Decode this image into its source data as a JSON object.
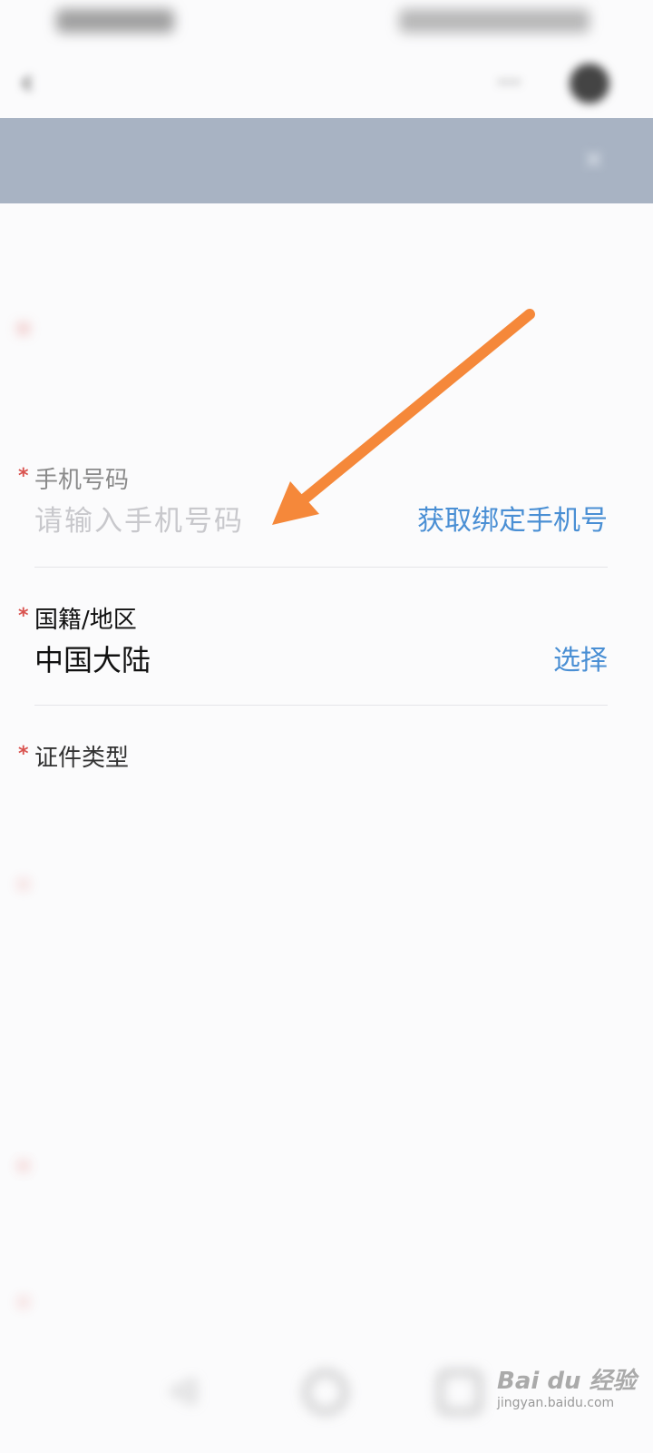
{
  "status_bar": {
    "left_text": "",
    "right_text": ""
  },
  "header": {
    "title": "",
    "back_icon": "chevron-left-icon",
    "more_icon": "more-dots-icon",
    "menu_icon": "target-circle-icon"
  },
  "notice": {
    "text": "",
    "close_icon": "close-icon"
  },
  "section": {
    "title": ""
  },
  "fields": {
    "name": {
      "label": "",
      "value": ""
    },
    "phone": {
      "label": "手机号码",
      "placeholder": "请输入手机号码",
      "action": "获取绑定手机号"
    },
    "nationality": {
      "label": "国籍/地区",
      "value": "中国大陆",
      "action": "选择"
    },
    "id_type": {
      "label": "证件类型",
      "value": "",
      "action": ""
    },
    "id_number": {
      "label": "",
      "value": ""
    },
    "gender": {
      "label": "",
      "value": "",
      "action": ""
    },
    "birthday": {
      "label": "",
      "value": "",
      "action": ""
    }
  },
  "help": {
    "text": "",
    "link": ""
  },
  "required_marker": "*",
  "watermark": {
    "main": "Bai du 经验",
    "sub": "jingyan.baidu.com"
  },
  "colors": {
    "accent": "#4a8fd4",
    "required": "#d9534f",
    "notice_bg": "#a8b3c3",
    "annotation_arrow": "#f5883a"
  }
}
